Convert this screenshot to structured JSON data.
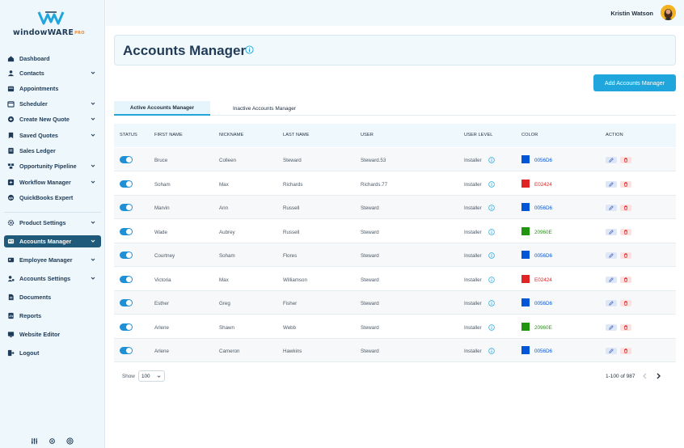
{
  "app": {
    "logo_text": "windowWARE",
    "logo_badge": "PRO"
  },
  "user": {
    "name": "Kristin Watson"
  },
  "sidebar": {
    "items": [
      {
        "label": "Dashboard",
        "icon": "home-icon",
        "chevron": false
      },
      {
        "label": "Contacts",
        "icon": "contacts-icon",
        "chevron": true
      },
      {
        "label": "Appointments",
        "icon": "appointments-icon",
        "chevron": false
      },
      {
        "label": "Scheduler",
        "icon": "scheduler-icon",
        "chevron": true
      },
      {
        "label": "Create New Quote",
        "icon": "plus-circle-icon",
        "chevron": true
      },
      {
        "label": "Saved Quotes",
        "icon": "bookmark-icon",
        "chevron": true
      },
      {
        "label": "Sales Ledger",
        "icon": "ledger-icon",
        "chevron": false
      },
      {
        "label": "Opportunity Pipeline",
        "icon": "pipeline-icon",
        "chevron": true
      },
      {
        "label": "Workflow Manager",
        "icon": "workflow-icon",
        "chevron": true
      },
      {
        "label": "QuickBooks Expert",
        "icon": "quickbooks-icon",
        "chevron": false
      },
      {
        "label": "Product Settings",
        "icon": "gear-icon",
        "chevron": true
      },
      {
        "label": "Accounts Manager",
        "icon": "accounts-manager-icon",
        "chevron": true,
        "active": true
      },
      {
        "label": "Employee Manager",
        "icon": "employee-icon",
        "chevron": true
      },
      {
        "label": "Accounts Settings",
        "icon": "account-settings-icon",
        "chevron": true
      },
      {
        "label": "Documents",
        "icon": "document-icon",
        "chevron": false
      },
      {
        "label": "Reports",
        "icon": "report-icon",
        "chevron": false
      },
      {
        "label": "Website Editor",
        "icon": "website-icon",
        "chevron": false
      },
      {
        "label": "Logout",
        "icon": "logout-icon",
        "chevron": false
      }
    ],
    "bottom_icons": [
      "sliders-icon",
      "settings-icon",
      "support-icon"
    ]
  },
  "page": {
    "title": "Accounts Manager"
  },
  "actions": {
    "add_label": "Add Accounts Manager"
  },
  "tabs": [
    {
      "label": "Active Accounts Manager",
      "active": true
    },
    {
      "label": "Inactive Accounts Manager",
      "active": false
    }
  ],
  "table": {
    "columns": [
      "STATUS",
      "FIRST NAME",
      "NICKNAME",
      "LAST NAME",
      "USER",
      "USER LEVEL",
      "COLOR",
      "ACTION"
    ],
    "rows": [
      {
        "first": "Bruce",
        "nick": "Colleen",
        "last": "Steward",
        "user": "Steward.53",
        "level": "Installer",
        "color": "#0056D6",
        "color_label": "0056D6"
      },
      {
        "first": "Soham",
        "nick": "Max",
        "last": "Richards",
        "user": "Richards.77",
        "level": "Installer",
        "color": "#E02424",
        "color_label": "E02424"
      },
      {
        "first": "Marvin",
        "nick": "Ann",
        "last": "Russell",
        "user": "Steward",
        "level": "Installer",
        "color": "#0056D6",
        "color_label": "0056D6"
      },
      {
        "first": "Wade",
        "nick": "Aubrey",
        "last": "Russell",
        "user": "Steward",
        "level": "Installer",
        "color": "#20960E",
        "color_label": "20960E"
      },
      {
        "first": "Courtney",
        "nick": "Soham",
        "last": "Flores",
        "user": "Steward",
        "level": "Installer",
        "color": "#0056D6",
        "color_label": "0056D6"
      },
      {
        "first": "Victoria",
        "nick": "Max",
        "last": "Williamson",
        "user": "Steward",
        "level": "Installer",
        "color": "#E02424",
        "color_label": "E02424"
      },
      {
        "first": "Esther",
        "nick": "Greg",
        "last": "Fisher",
        "user": "Steward",
        "level": "Installer",
        "color": "#0056D6",
        "color_label": "0056D6"
      },
      {
        "first": "Arlene",
        "nick": "Shawn",
        "last": "Webb",
        "user": "Steward",
        "level": "Installer",
        "color": "#20960E",
        "color_label": "20960E"
      },
      {
        "first": "Arlene",
        "nick": "Cameron",
        "last": "Hawkins",
        "user": "Steward",
        "level": "Installer",
        "color": "#0056D6",
        "color_label": "0056D6"
      }
    ]
  },
  "footer": {
    "show_label": "Show",
    "page_size": "100",
    "range": "1-100 of 987"
  },
  "colors": {
    "accent": "#1FA6DC",
    "sidebar_active": "#1F5A7A",
    "title": "#1F3B57"
  }
}
